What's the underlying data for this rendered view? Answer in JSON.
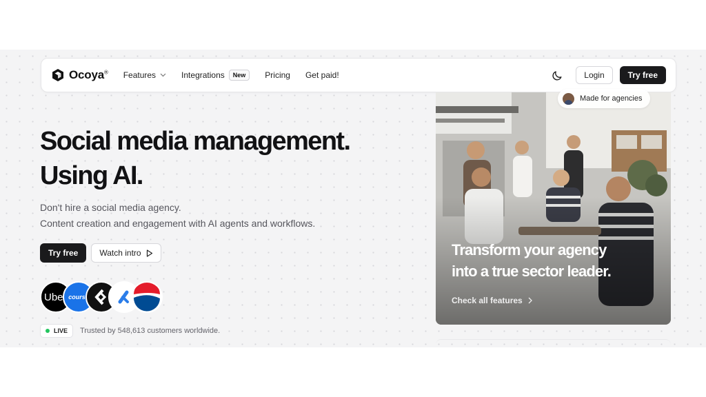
{
  "nav": {
    "logo": "Ocoya",
    "logo_mark": "®",
    "links": [
      {
        "label": "Features"
      },
      {
        "label": "Integrations",
        "badge": "New"
      },
      {
        "label": "Pricing"
      },
      {
        "label": "Get paid!"
      }
    ],
    "login_label": "Login",
    "try_label": "Try free"
  },
  "hero": {
    "title_line1": "Social media management.",
    "title_line2": "Using AI.",
    "sub_line1": "Don't hire a social media agency.",
    "sub_line2": "Content creation and engagement with AI agents and workflows.",
    "try_label": "Try free",
    "watch_label": "Watch intro",
    "brands": [
      "Uber",
      "course",
      "",
      "",
      ""
    ],
    "live_label": "LIVE",
    "trusted_text": "Trusted by 548,613 customers worldwide."
  },
  "card": {
    "pill_label": "Made for agencies",
    "headline_line1": "Transform your agency",
    "headline_line2": "into a true sector leader.",
    "link_label": "Check all features"
  },
  "colors": {
    "accent_dark": "#1a1a1c",
    "live_green": "#22c55e",
    "background": "#f4f4f5"
  }
}
